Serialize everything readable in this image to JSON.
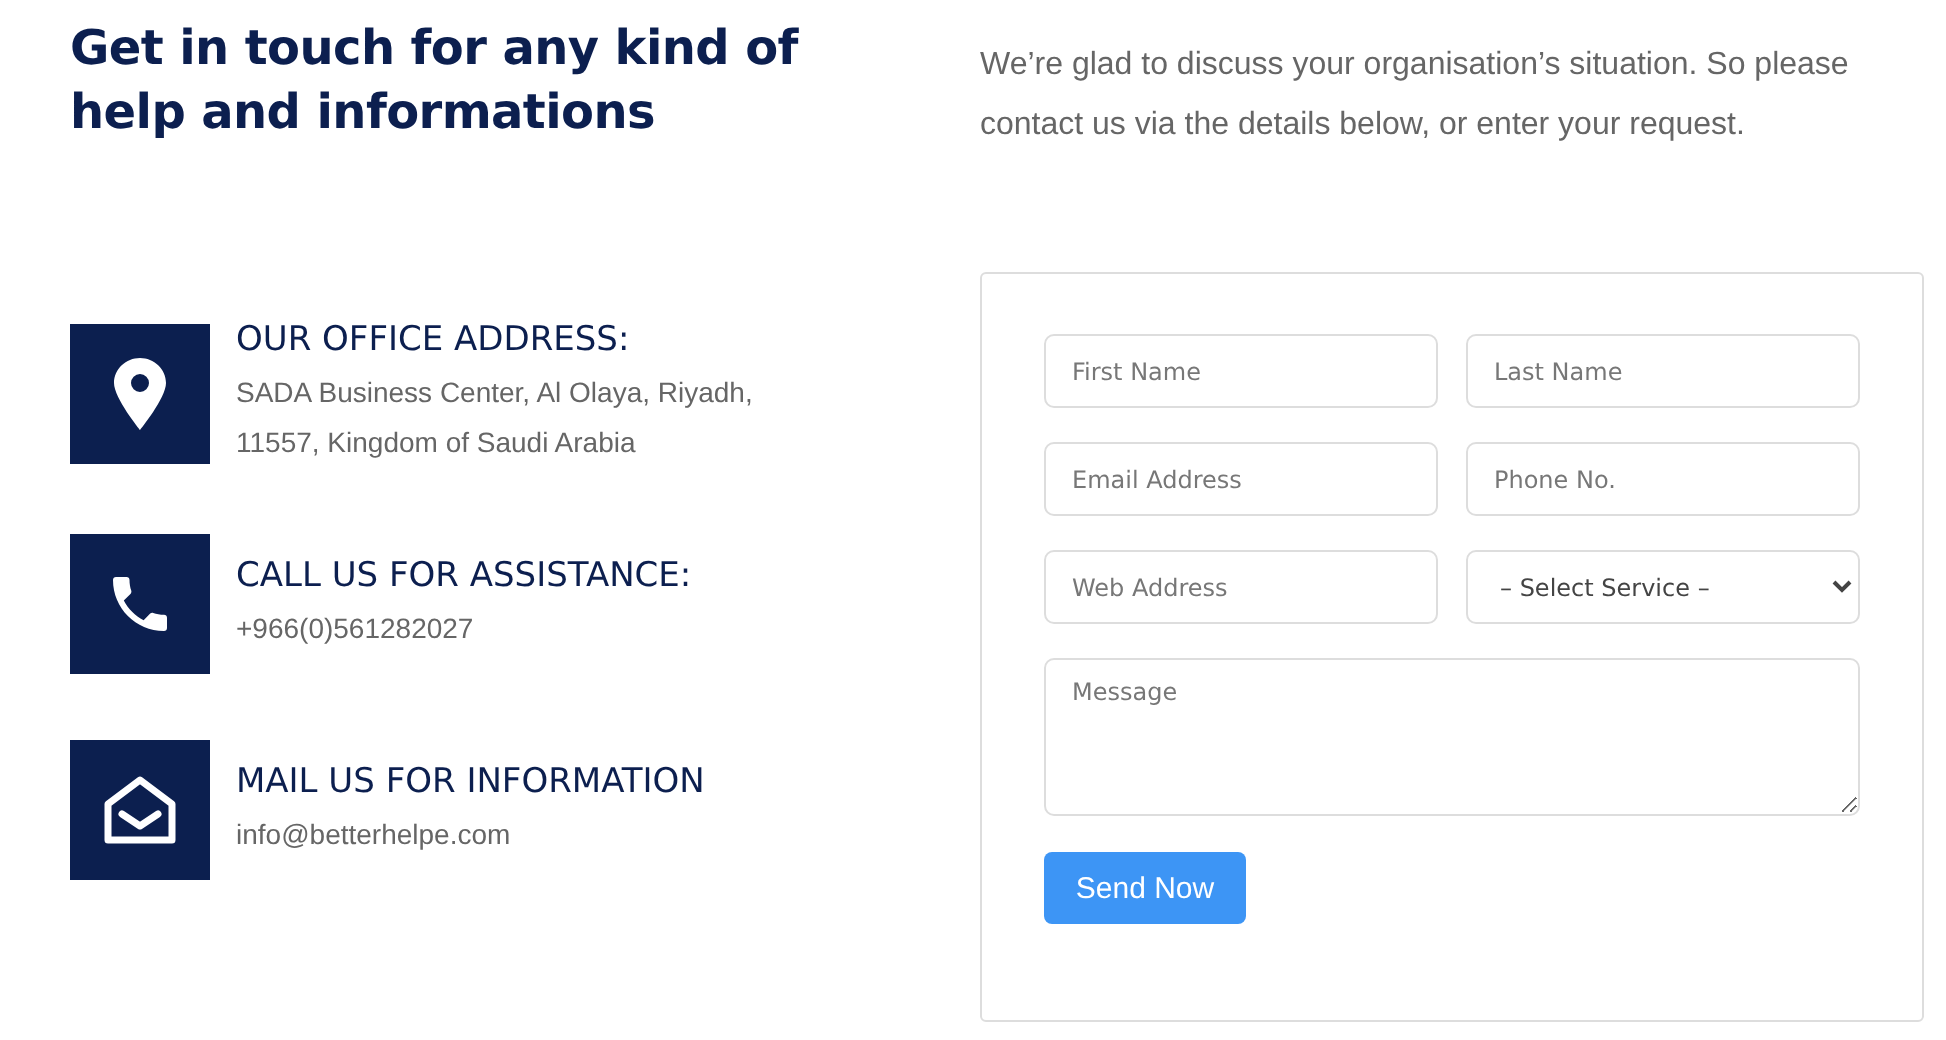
{
  "heading": "Get in touch for any kind of help and informations",
  "intro": "We’re glad to discuss your organisation’s situation. So please contact us via the details below, or enter your request.",
  "contacts": [
    {
      "kind": "address",
      "title": "OUR OFFICE ADDRESS:",
      "text": "SADA Business Center, Al Olaya, Riyadh, 11557, Kingdom of Saudi Arabia"
    },
    {
      "kind": "phone",
      "title": "CALL US FOR ASSISTANCE:",
      "text": "+966(0)561282027"
    },
    {
      "kind": "mail",
      "title": "MAIL US FOR INFORMATION",
      "text": "info@betterhelpe.com"
    }
  ],
  "form": {
    "fields": [
      {
        "kind": "text",
        "placeholder": "First Name"
      },
      {
        "kind": "text",
        "placeholder": "Last Name"
      },
      {
        "kind": "text",
        "placeholder": "Email Address"
      },
      {
        "kind": "text",
        "placeholder": "Phone No."
      },
      {
        "kind": "text",
        "placeholder": "Web Address"
      },
      {
        "kind": "select",
        "value": "– Select Service –"
      },
      {
        "kind": "textarea",
        "placeholder": "Message"
      }
    ],
    "submit": "Send Now"
  }
}
